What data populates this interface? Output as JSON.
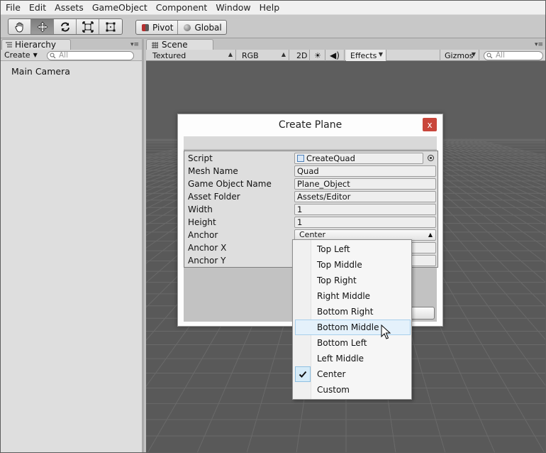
{
  "menubar": {
    "items": [
      "File",
      "Edit",
      "Assets",
      "GameObject",
      "Component",
      "Window",
      "Help"
    ]
  },
  "toolbar": {
    "tools": [
      {
        "icon": "hand-icon",
        "active": false
      },
      {
        "icon": "move-icon",
        "active": true
      },
      {
        "icon": "rotate-icon",
        "active": false
      },
      {
        "icon": "scale-icon",
        "active": false
      },
      {
        "icon": "rect-tool-icon",
        "active": false
      }
    ],
    "pivot_label": "Pivot",
    "global_label": "Global"
  },
  "hierarchy": {
    "tab_label": "Hierarchy",
    "create_label": "Create",
    "search_placeholder": "All",
    "items": [
      "Main Camera"
    ]
  },
  "scene": {
    "tab_label": "Scene",
    "shading_mode": "Textured",
    "render_mode": "RGB",
    "mode_2d": "2D",
    "effects_label": "Effects",
    "gizmos_label": "Gizmos",
    "search_placeholder": "All",
    "background_color": "#595959",
    "grid_color": "#6a6a6a"
  },
  "dialog": {
    "title": "Create Plane",
    "close_symbol": "x",
    "fields": [
      {
        "label": "Script",
        "value": "CreateQuad",
        "kind": "object"
      },
      {
        "label": "Mesh Name",
        "value": "Quad",
        "kind": "text"
      },
      {
        "label": "Game Object Name",
        "value": "Plane_Object",
        "kind": "text"
      },
      {
        "label": "Asset Folder",
        "value": "Assets/Editor",
        "kind": "text"
      },
      {
        "label": "Width",
        "value": "1",
        "kind": "text"
      },
      {
        "label": "Height",
        "value": "1",
        "kind": "text"
      },
      {
        "label": "Anchor",
        "value": "Center",
        "kind": "popup"
      },
      {
        "label": "Anchor X",
        "value": "",
        "kind": "text"
      },
      {
        "label": "Anchor Y",
        "value": "",
        "kind": "text"
      }
    ]
  },
  "anchor_dropdown": {
    "options": [
      "Top Left",
      "Top Middle",
      "Top Right",
      "Right Middle",
      "Bottom Right",
      "Bottom Middle",
      "Bottom Left",
      "Left Middle",
      "Center",
      "Custom"
    ],
    "selected": "Center",
    "hovered": "Bottom Middle",
    "accent_color": "#e4f1fb"
  }
}
